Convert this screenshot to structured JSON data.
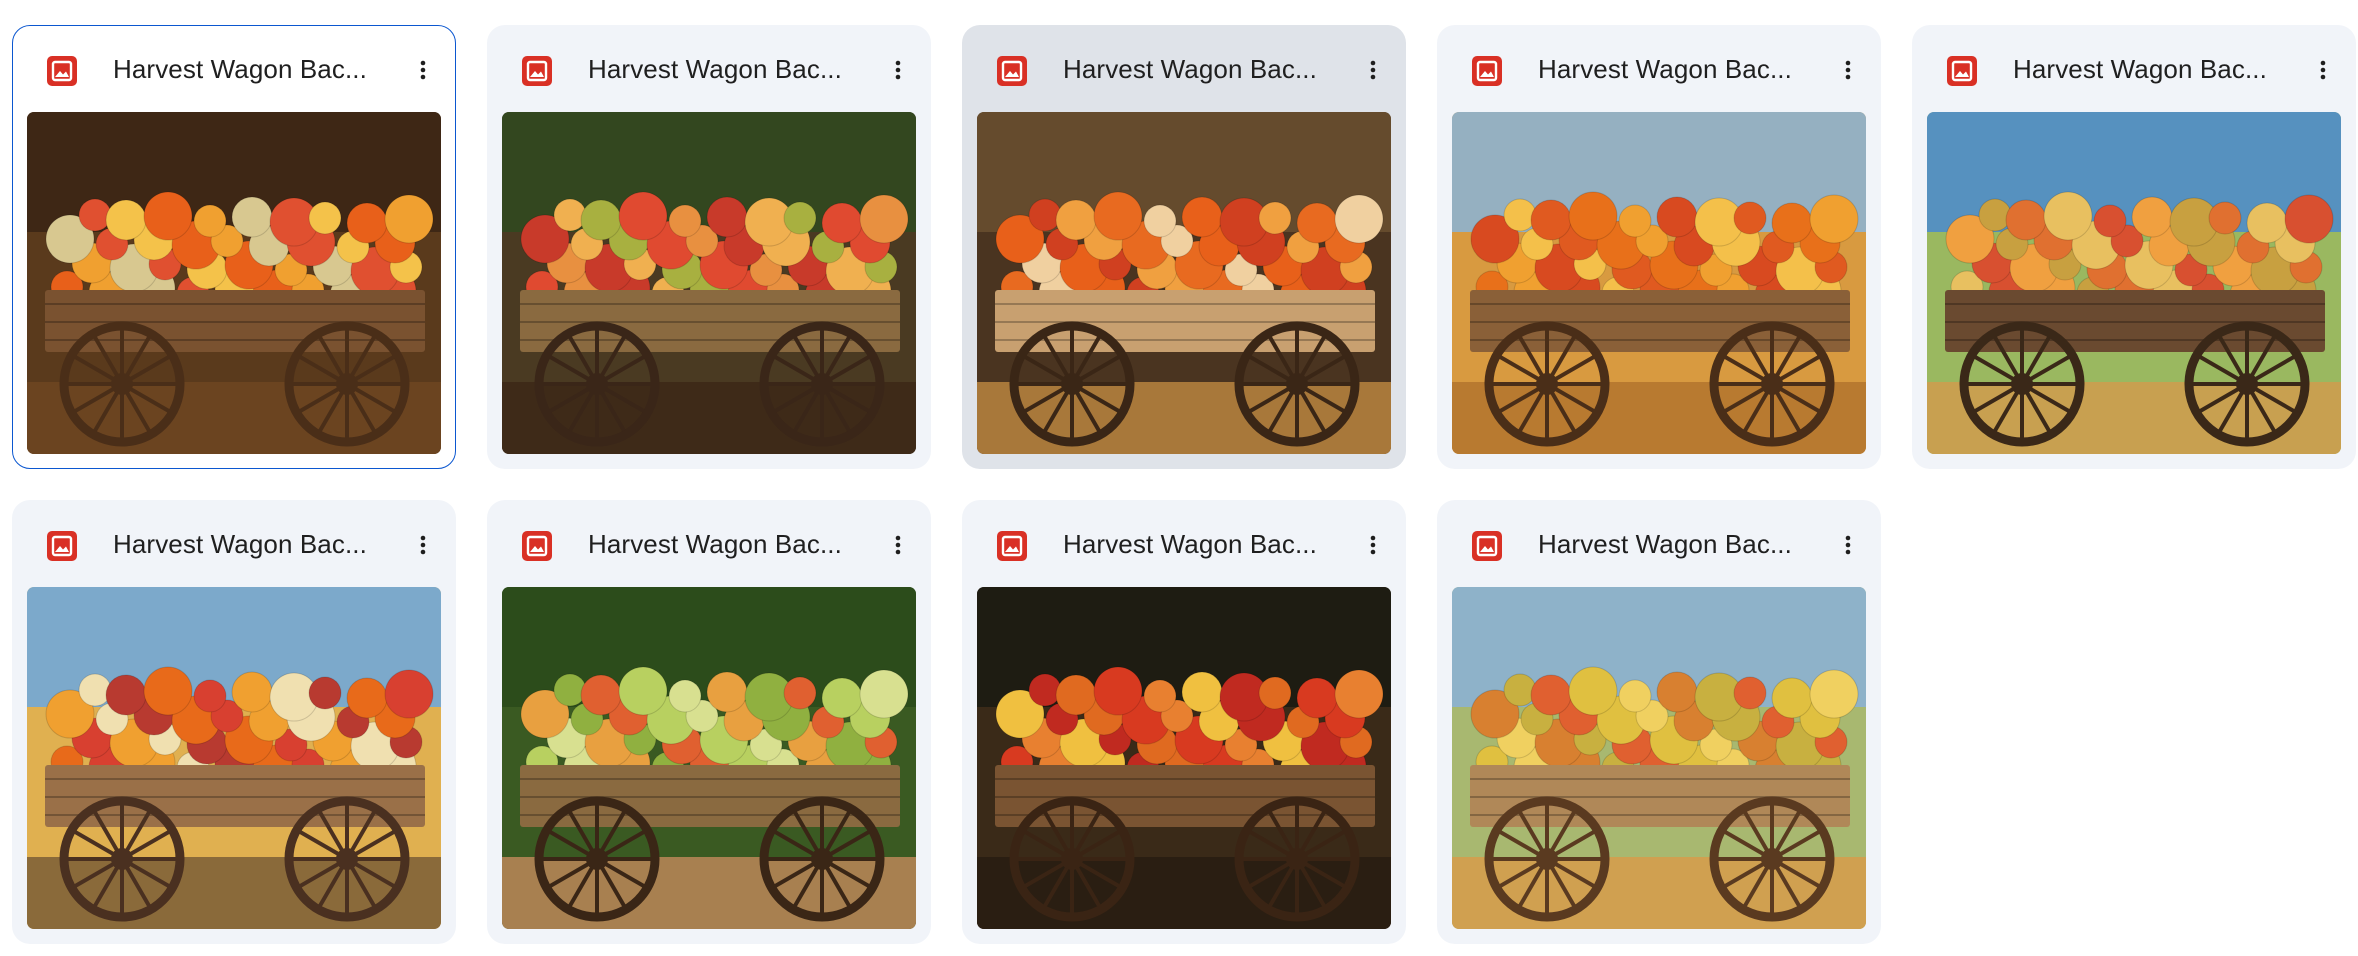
{
  "files": [
    {
      "title": "Harvest Wagon Bac...",
      "type_icon": "image-file-icon",
      "state": "selected",
      "scene": {
        "sky": "#3a2414",
        "bg": "#5a3a1c",
        "ground": "#6b4420",
        "load": [
          "#e8601a",
          "#f0a030",
          "#d8c890",
          "#e05030",
          "#f4c24a"
        ],
        "wagon": "#7a5230",
        "wheel": "#4a2e18"
      }
    },
    {
      "title": "Harvest Wagon Bac...",
      "type_icon": "image-file-icon",
      "state": "normal",
      "scene": {
        "sky": "#2f4a1e",
        "bg": "#4a3a22",
        "ground": "#3e2a18",
        "load": [
          "#e04a30",
          "#e89040",
          "#c83a2a",
          "#f0b050",
          "#a8b040"
        ],
        "wagon": "#8a6a40",
        "wheel": "#3a2618"
      }
    },
    {
      "title": "Harvest Wagon Bac...",
      "type_icon": "image-file-icon",
      "state": "hovered",
      "scene": {
        "sky": "#6a5030",
        "bg": "#4a3420",
        "ground": "#a8783a",
        "load": [
          "#e86a20",
          "#f0d0a0",
          "#e8601a",
          "#d04020",
          "#f0a040"
        ],
        "wagon": "#c8a070",
        "wheel": "#3a2616"
      }
    },
    {
      "title": "Harvest Wagon Bac...",
      "type_icon": "image-file-icon",
      "state": "normal",
      "scene": {
        "sky": "#8ab4d8",
        "bg": "#d89a40",
        "ground": "#b87a30",
        "load": [
          "#e8701a",
          "#f0a030",
          "#d84a20",
          "#f4c04a",
          "#e05a20"
        ],
        "wagon": "#8a6038",
        "wheel": "#4a2e18"
      }
    },
    {
      "title": "Harvest Wagon Bac...",
      "type_icon": "image-file-icon",
      "state": "normal",
      "scene": {
        "sky": "#4a8ad0",
        "bg": "#9ab860",
        "ground": "#c8a050",
        "load": [
          "#e8c060",
          "#d85030",
          "#f0a040",
          "#c8a040",
          "#e07030"
        ],
        "wagon": "#6a4a30",
        "wheel": "#3a2818"
      }
    },
    {
      "title": "Harvest Wagon Bac...",
      "type_icon": "image-file-icon",
      "state": "normal",
      "scene": {
        "sky": "#6aa8e0",
        "bg": "#e0b050",
        "ground": "#8a6a3a",
        "load": [
          "#e86a1a",
          "#d84030",
          "#f0a030",
          "#f0e0b0",
          "#b83a30"
        ],
        "wagon": "#9a7048",
        "wheel": "#4a3020"
      }
    },
    {
      "title": "Harvest Wagon Bac...",
      "type_icon": "image-file-icon",
      "state": "normal",
      "scene": {
        "sky": "#2a4a1a",
        "bg": "#3a5a22",
        "ground": "#a88050",
        "load": [
          "#b8d060",
          "#d8e090",
          "#e8a040",
          "#90b040",
          "#e06030"
        ],
        "wagon": "#8a6a40",
        "wheel": "#3a2616"
      }
    },
    {
      "title": "Harvest Wagon Bac...",
      "type_icon": "image-file-icon",
      "state": "normal",
      "scene": {
        "sky": "#1a1a12",
        "bg": "#3a2a18",
        "ground": "#2a1e12",
        "load": [
          "#d83a20",
          "#e88030",
          "#f0c040",
          "#c02a20",
          "#e06a20"
        ],
        "wagon": "#7a5432",
        "wheel": "#3a2414"
      }
    },
    {
      "title": "Harvest Wagon Bac...",
      "type_icon": "image-file-icon",
      "state": "normal",
      "scene": {
        "sky": "#8ab0d8",
        "bg": "#a8b870",
        "ground": "#d0a050",
        "load": [
          "#e0c040",
          "#f0d060",
          "#d88030",
          "#c8b040",
          "#e06030"
        ],
        "wagon": "#b08858",
        "wheel": "#5a3a20"
      }
    }
  ],
  "card_icons": {
    "more": "more-vertical-icon"
  },
  "colors": {
    "selected_border": "#0b57d0",
    "card_bg": "#f1f4f9",
    "hover_bg": "#dfe3e9",
    "file_icon": "#d93025"
  }
}
